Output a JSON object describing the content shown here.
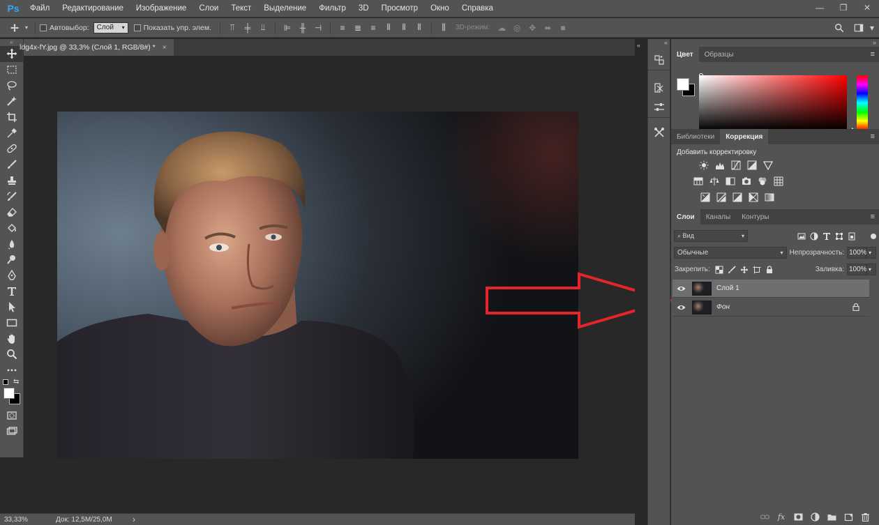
{
  "app": {
    "logo": "Ps"
  },
  "menu": [
    "Файл",
    "Редактирование",
    "Изображение",
    "Слои",
    "Текст",
    "Выделение",
    "Фильтр",
    "3D",
    "Просмотр",
    "Окно",
    "Справка"
  ],
  "window_controls": {
    "minimize": "—",
    "restore": "❐",
    "close": "✕"
  },
  "options": {
    "autoselect_label": "Автовыбор:",
    "autoselect_value": "Слой",
    "show_controls_label": "Показать упр. элем.",
    "mode3d_label": "3D-режим:"
  },
  "document": {
    "tab_title": "ldg4x-fY.jpg @ 33,3% (Слой 1, RGB/8#) *",
    "tab_close": "×"
  },
  "status": {
    "zoom": "33,33%",
    "doc_info": "Док: 12,5M/25,0M",
    "arrow": "›"
  },
  "panels": {
    "color": {
      "tabs": [
        "Цвет",
        "Образцы"
      ],
      "active_tab": "Цвет"
    },
    "adjustments": {
      "tabs": [
        "Библиотеки",
        "Коррекция"
      ],
      "active_tab": "Коррекция",
      "title": "Добавить корректировку"
    },
    "layers": {
      "tabs": [
        "Слои",
        "Каналы",
        "Контуры"
      ],
      "active_tab": "Слои",
      "filter_kind": "Вид",
      "blend_mode": "Обычные",
      "opacity_label": "Непрозрачность:",
      "opacity_value": "100%",
      "lock_label": "Закрепить:",
      "fill_label": "Заливка:",
      "fill_value": "100%",
      "items": [
        {
          "name": "Слой 1",
          "selected": true,
          "visible": true,
          "locked": false
        },
        {
          "name": "Фон",
          "selected": false,
          "visible": true,
          "locked": true
        }
      ]
    }
  },
  "colors": {
    "accent_logo": "#31a8ff",
    "foreground": "#ffffff",
    "background": "#000000",
    "annotation_arrow": "#e5252a"
  }
}
